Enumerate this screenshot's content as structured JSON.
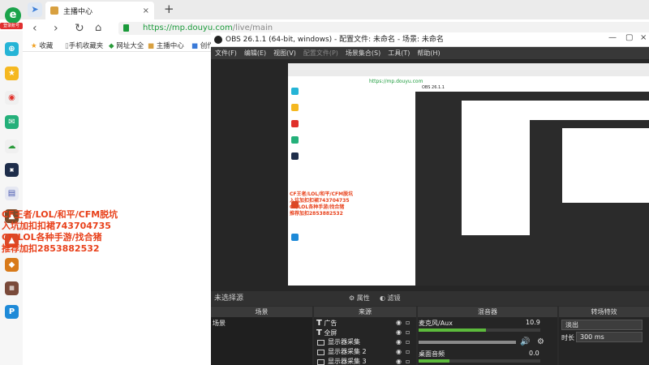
{
  "browser": {
    "tab_title": "主播中心",
    "new_tab": "+",
    "url_scheme": "https://",
    "url_host": "mp.douyu.com",
    "url_path": "/live/main",
    "bookmarks": [
      "收藏",
      "手机收藏夹",
      "网址大全",
      "主播中心",
      "创作"
    ],
    "login_badge": "登录账号"
  },
  "overlay": {
    "line1": "CF王者/LOL/和平/CFM脱坑",
    "line2": "入坑加扣扣裙743704735",
    "line3": "CF/LOL各种手游/找合猪",
    "line4": "推荐加扣2853882532"
  },
  "obs": {
    "title": "OBS 26.1.1 (64-bit, windows) - 配置文件: 未命名 - 场景: 未命名",
    "menu": [
      "文件(F)",
      "编辑(E)",
      "视图(V)",
      "配置文件(P)",
      "场景集合(S)",
      "工具(T)",
      "帮助(H)"
    ],
    "no_source_selected": "未选择源",
    "props_button": "属性",
    "filters_button": "滤镜",
    "docks": {
      "scenes": "场景",
      "sources": "来源",
      "mixer": "混音器",
      "transitions": "转场特效"
    },
    "scenes": [
      "场景"
    ],
    "sources": [
      "广告",
      "全屏",
      "显示器采集",
      "显示器采集 2",
      "显示器采集 3"
    ],
    "mixer": [
      {
        "name": "麦克风/Aux",
        "db": "10.9",
        "level": 0.55
      },
      {
        "name": "桌面音频",
        "db": "0.0",
        "level": 0.25
      }
    ],
    "transition_select": "淡出",
    "duration_label": "时长",
    "duration_value": "300 ms"
  },
  "colors": {
    "brand_green": "#1aa34a",
    "overlay_red": "#e8401a",
    "obs_bg": "#2b2b2b"
  }
}
